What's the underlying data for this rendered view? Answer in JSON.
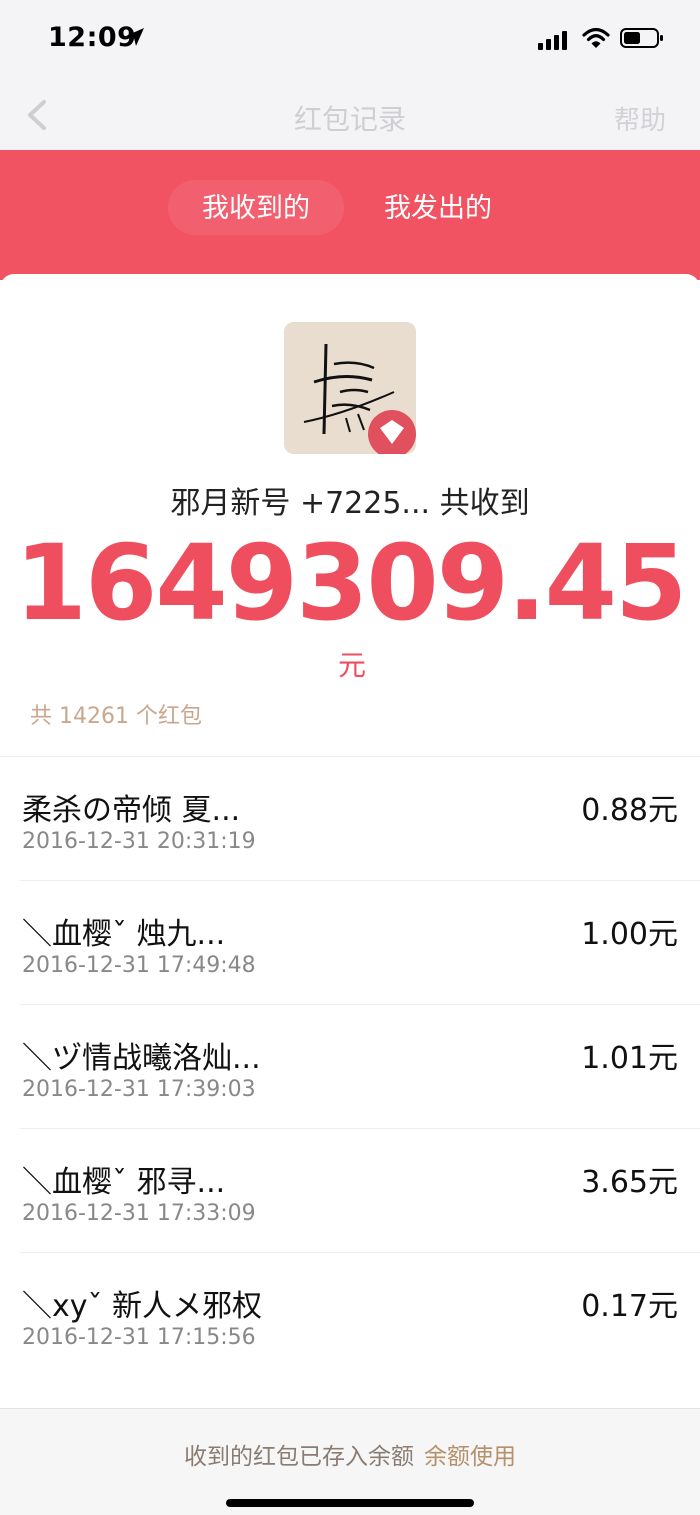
{
  "status": {
    "time": "12:09"
  },
  "nav": {
    "title": "红包记录",
    "right": "帮助"
  },
  "tabs": {
    "received": "我收到的",
    "sent": "我发出的"
  },
  "summary": {
    "text": "邪月新号 +7225... 共收到",
    "amount": "1649309.45",
    "unit": "元",
    "count_text": "共 14261 个红包"
  },
  "records": [
    {
      "name": "柔杀の帝倾 夏...",
      "date": "2016-12-31 20:31:19",
      "amount": "0.88元"
    },
    {
      "name": "＼血樱ˇ 烛九...",
      "date": "2016-12-31 17:49:48",
      "amount": "1.00元"
    },
    {
      "name": "＼ヅ情战曦洛灿...",
      "date": "2016-12-31 17:39:03",
      "amount": "1.01元"
    },
    {
      "name": "＼血樱ˇ 邪寻...",
      "date": "2016-12-31 17:33:09",
      "amount": "3.65元"
    },
    {
      "name": "＼xyˇ 新人メ邪权",
      "date": "2016-12-31 17:15:56",
      "amount": "0.17元"
    }
  ],
  "footer": {
    "text": "收到的红包已存入余额",
    "link": "余额使用"
  },
  "colors": {
    "brand_red": "#f15363",
    "amount_red": "#ef4e5f"
  }
}
